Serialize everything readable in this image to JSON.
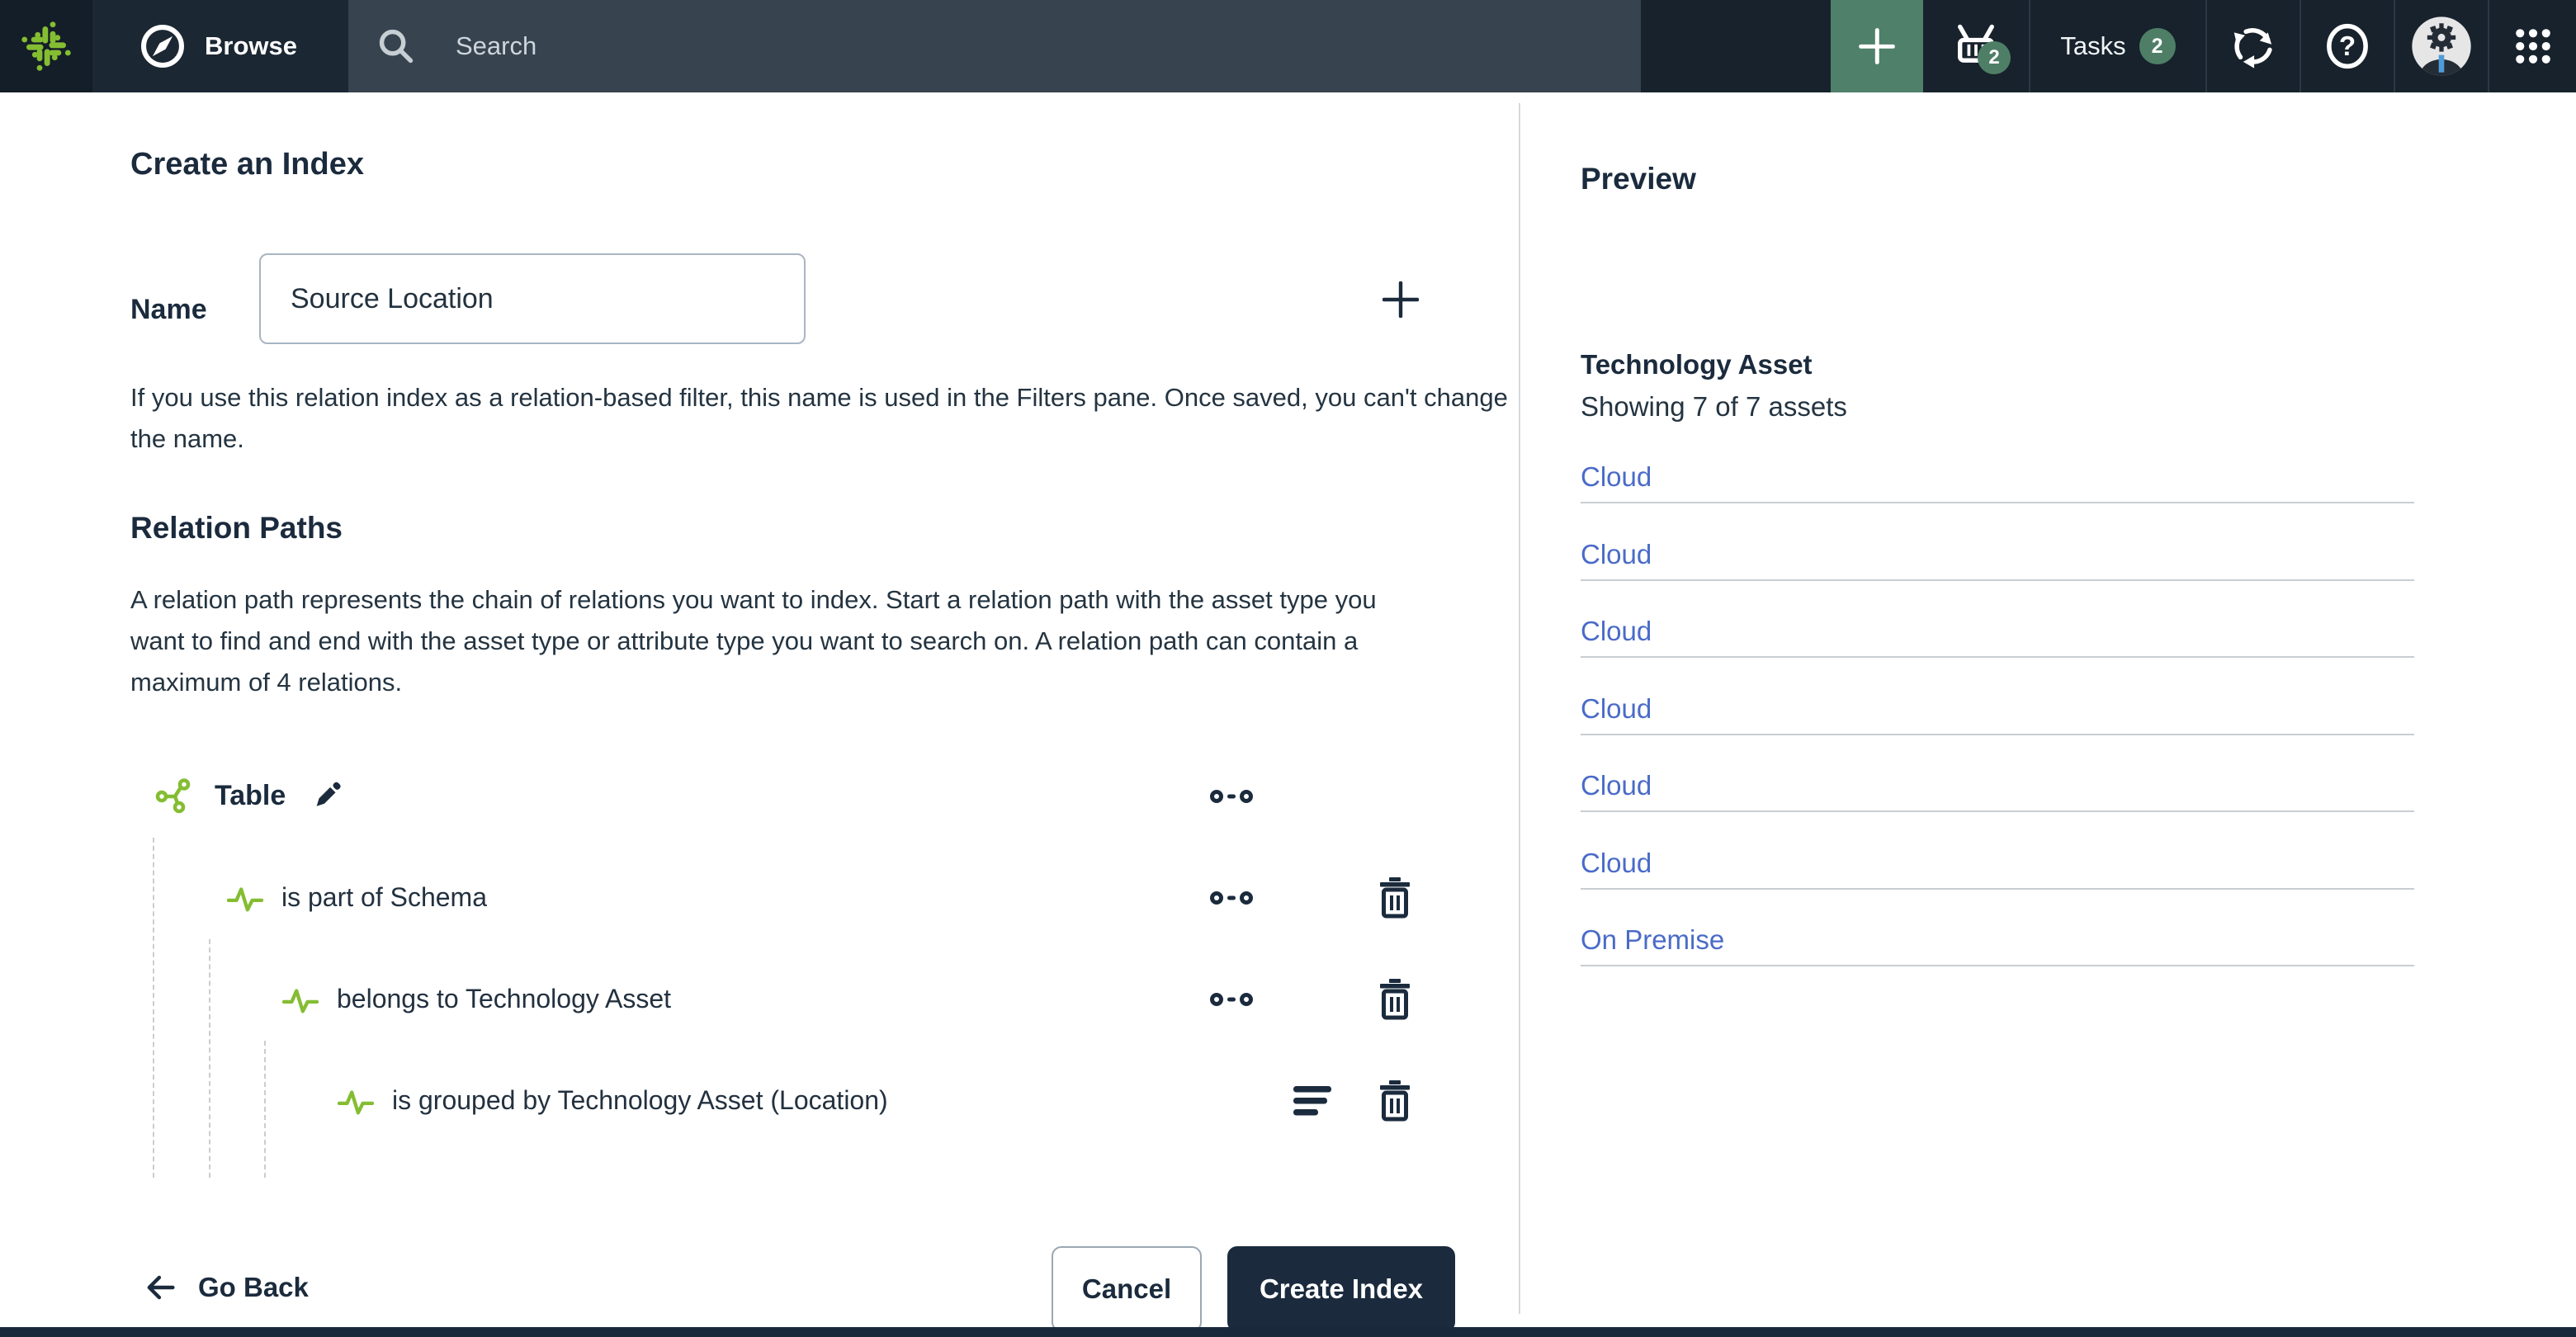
{
  "colors": {
    "accent_green": "#84bd32",
    "tile_green": "#4f8069",
    "badge_green": "#4e7f66",
    "navy": "#1b2b3d",
    "link_blue": "#4a6bc8"
  },
  "navbar": {
    "browse_label": "Browse",
    "search_placeholder": "Search",
    "basket_badge": "2",
    "tasks_label": "Tasks",
    "tasks_badge": "2"
  },
  "page": {
    "title": "Create an Index",
    "name_label": "Name",
    "name_value": "Source Location",
    "name_help": "If you use this relation index as a relation-based filter, this name is used in the Filters pane. Once saved, you can't change the name.",
    "relation_paths": {
      "heading": "Relation Paths",
      "description": "A relation path represents the chain of relations you want to index. Start a relation path with the asset type you want to find and end with the asset type or attribute type you want to search on. A relation path can contain a maximum of 4 relations.",
      "root_label": "Table",
      "rows": [
        {
          "label": "is part of Schema"
        },
        {
          "label": "belongs to Technology Asset"
        },
        {
          "label": "is grouped by Technology Asset (Location)"
        }
      ]
    },
    "footer": {
      "go_back": "Go Back",
      "cancel": "Cancel",
      "create": "Create Index"
    }
  },
  "preview": {
    "heading": "Preview",
    "asset_type": "Technology Asset",
    "count_text": "Showing 7 of 7 assets",
    "items": [
      "Cloud",
      "Cloud",
      "Cloud",
      "Cloud",
      "Cloud",
      "Cloud",
      "On Premise"
    ]
  }
}
